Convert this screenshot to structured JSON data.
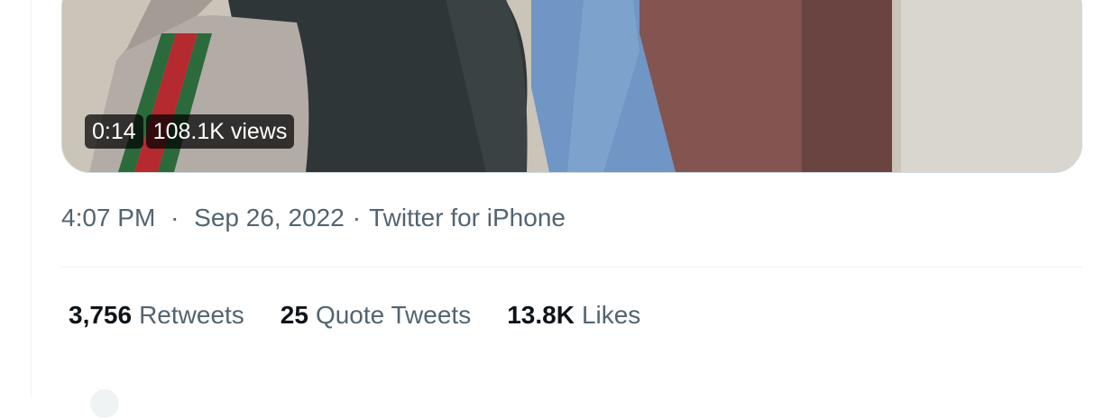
{
  "video": {
    "duration": "0:14",
    "views": "108.1K views"
  },
  "tweet_meta": {
    "time": "4:07 PM",
    "separator": "·",
    "date": "Sep 26, 2022",
    "source": "Twitter for iPhone"
  },
  "stats": {
    "retweets": {
      "count": "3,756",
      "label": "Retweets"
    },
    "quotes": {
      "count": "25",
      "label": "Quote Tweets"
    },
    "likes": {
      "count": "13.8K",
      "label": "Likes"
    }
  },
  "colors": {
    "primary_text": "#0f1419",
    "secondary_text": "#536471",
    "divider": "#eff3f4",
    "media_border": "#cfd9de"
  }
}
